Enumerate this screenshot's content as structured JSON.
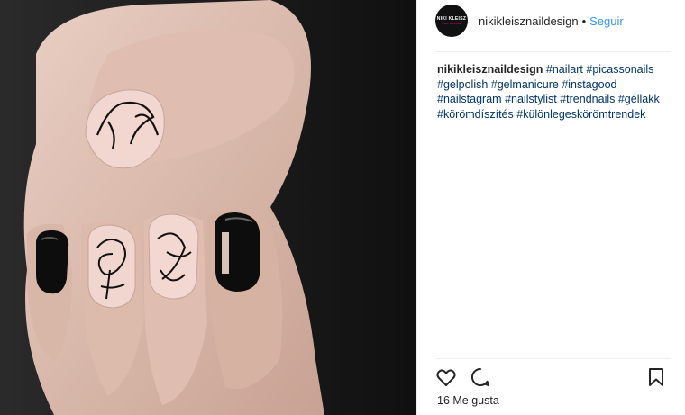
{
  "photo": {
    "alt": ""
  },
  "header": {
    "avatar_text_top": "NIKI KLEISZ",
    "avatar_text_bottom": "NAIL DESIGN",
    "username": "nikikleisznaildesign",
    "separator": "•",
    "follow_label": "Seguir"
  },
  "caption": {
    "username": "nikikleisznaildesign",
    "hashtags": [
      "#nailart",
      "#picassonails",
      "#gelpolish",
      "#gelmanicure",
      "#instagood",
      "#nailstagram",
      "#nailstylist",
      "#trendnails",
      "#géllakk",
      "#körömdíszítés",
      "#különlegeskörömtrendek"
    ]
  },
  "actions": {
    "like_icon": "heart-icon",
    "comment_icon": "comment-icon",
    "save_icon": "bookmark-icon"
  },
  "likes": {
    "text": "16 Me gusta"
  },
  "colors": {
    "link": "#3897f0",
    "hashtag": "#003569",
    "text": "#262626",
    "divider": "#efefef"
  }
}
